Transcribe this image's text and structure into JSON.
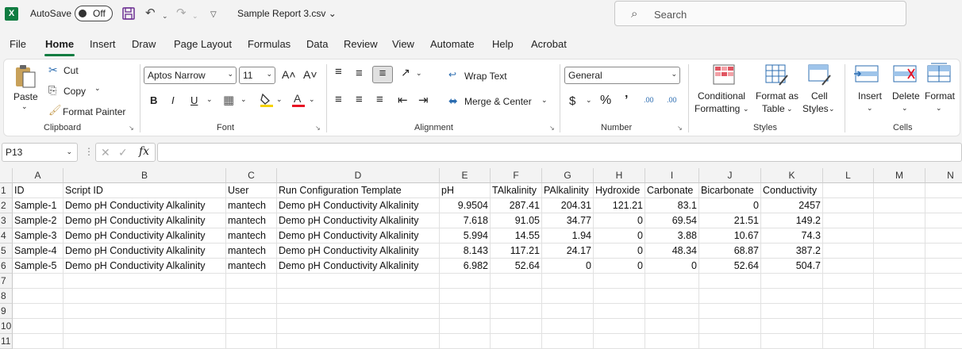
{
  "app": {
    "logo": "X",
    "autosave_label": "AutoSave",
    "autosave_state": "Off",
    "filename": "Sample Report 3.csv ⌄",
    "search_placeholder": "Search"
  },
  "menu": [
    "File",
    "Home",
    "Insert",
    "Draw",
    "Page Layout",
    "Formulas",
    "Data",
    "Review",
    "View",
    "Automate",
    "Help",
    "Acrobat"
  ],
  "ribbon": {
    "clipboard": {
      "paste": "Paste",
      "cut": "Cut",
      "copy": "Copy",
      "format_painter": "Format Painter",
      "label": "Clipboard"
    },
    "font": {
      "name": "Aptos Narrow",
      "size": "11",
      "bold": "B",
      "italic": "I",
      "underline": "U",
      "label": "Font",
      "grow": "A˄",
      "shrink": "A˅"
    },
    "alignment": {
      "wrap_text": "Wrap Text",
      "merge_center": "Merge & Center",
      "label": "Alignment"
    },
    "number": {
      "format": "General",
      "currency": "$",
      "percent": "%",
      "comma": "’",
      "inc_dec": ".00",
      "dec_dec": ".00",
      "label": "Number"
    },
    "styles": {
      "conditional": "Conditional",
      "conditional2": "Formatting",
      "format_as": "Format as",
      "format_as2": "Table",
      "cell": "Cell",
      "cell2": "Styles",
      "label": "Styles"
    },
    "cells": {
      "insert": "Insert",
      "delete": "Delete",
      "format": "Format",
      "label": "Cells"
    }
  },
  "formula_bar": {
    "name_box": "P13",
    "fx": "fx",
    "formula": ""
  },
  "grid": {
    "columns": [
      "A",
      "B",
      "C",
      "D",
      "E",
      "F",
      "G",
      "H",
      "I",
      "J",
      "K",
      "L",
      "M",
      "N"
    ],
    "row_numbers": [
      "1",
      "2",
      "3",
      "4",
      "5",
      "6",
      "7",
      "8",
      "9",
      "10",
      "11"
    ],
    "rows": [
      [
        "ID",
        "Script ID",
        "User",
        "Run Configuration Template",
        "pH",
        "TAlkalinity",
        "PAlkalinity",
        "Hydroxide",
        "Carbonate",
        "Bicarbonate",
        "Conductivity"
      ],
      [
        "Sample-1",
        "Demo pH Conductivity Alkalinity",
        "mantech",
        "Demo pH Conductivity Alkalinity",
        "9.9504",
        "287.41",
        "204.31",
        "121.21",
        "83.1",
        "0",
        "2457"
      ],
      [
        "Sample-2",
        "Demo pH Conductivity Alkalinity",
        "mantech",
        "Demo pH Conductivity Alkalinity",
        "7.618",
        "91.05",
        "34.77",
        "0",
        "69.54",
        "21.51",
        "149.2"
      ],
      [
        "Sample-3",
        "Demo pH Conductivity Alkalinity",
        "mantech",
        "Demo pH Conductivity Alkalinity",
        "5.994",
        "14.55",
        "1.94",
        "0",
        "3.88",
        "10.67",
        "74.3"
      ],
      [
        "Sample-4",
        "Demo pH Conductivity Alkalinity",
        "mantech",
        "Demo pH Conductivity Alkalinity",
        "8.143",
        "117.21",
        "24.17",
        "0",
        "48.34",
        "68.87",
        "387.2"
      ],
      [
        "Sample-5",
        "Demo pH Conductivity Alkalinity",
        "mantech",
        "Demo pH Conductivity Alkalinity",
        "6.982",
        "52.64",
        "0",
        "0",
        "0",
        "52.64",
        "504.7"
      ]
    ]
  },
  "colors": {
    "accent": "#107c41",
    "paste_icon": "#c8a15a",
    "fill_yellow": "#f7d300",
    "font_red": "#e81123"
  }
}
